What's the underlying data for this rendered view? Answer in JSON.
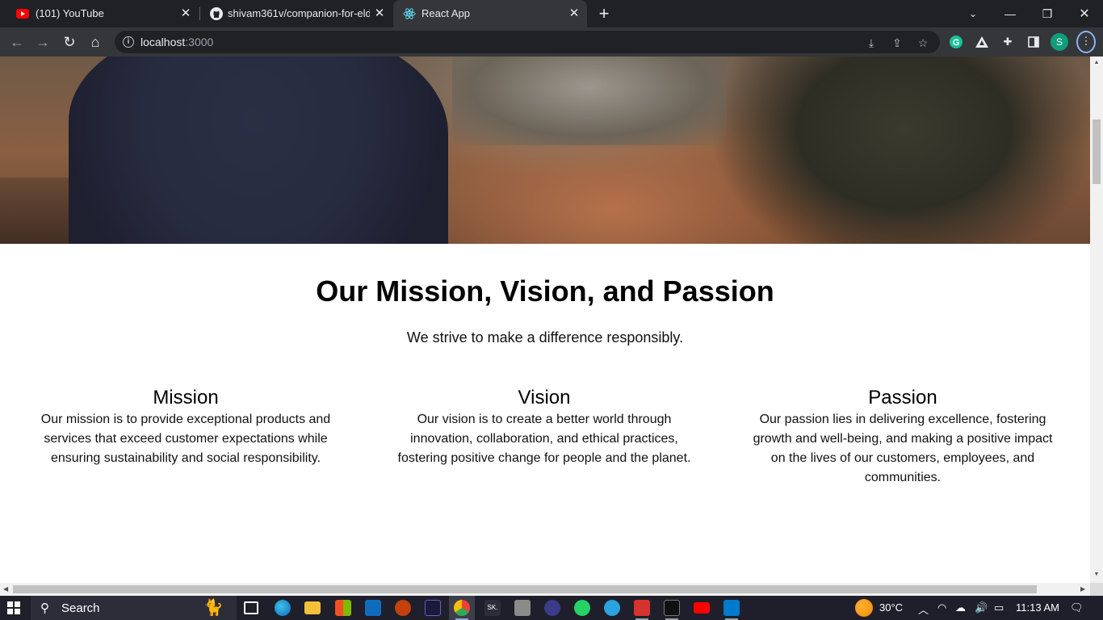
{
  "browser": {
    "tabs": [
      {
        "title": "(101) YouTube",
        "icon": "youtube-icon",
        "active": false
      },
      {
        "title": "shivam361v/companion-for-elde",
        "icon": "github-icon",
        "active": false
      },
      {
        "title": "React App",
        "icon": "react-icon",
        "active": true
      }
    ],
    "address": {
      "host": "localhost",
      "port": ":3000"
    },
    "profile_initial": "S"
  },
  "page": {
    "section_title": "Our Mission, Vision, and Passion",
    "section_subtitle": "We strive to make a difference responsibly.",
    "columns": [
      {
        "heading": "Mission",
        "text": "Our mission is to provide exceptional products and services that exceed customer expectations while ensuring sustainability and social responsibility."
      },
      {
        "heading": "Vision",
        "text": "Our vision is to create a better world through innovation, collaboration, and ethical practices, fostering positive change for people and the planet."
      },
      {
        "heading": "Passion",
        "text": "Our passion lies in delivering excellence, fostering growth and well-being, and making a positive impact on the lives of our customers, employees, and communities."
      }
    ]
  },
  "taskbar": {
    "search_label": "Search",
    "temperature": "30°C",
    "time": "11:13 AM"
  },
  "colors": {
    "tabbar_bg": "#202124",
    "toolbar_bg": "#35363a",
    "taskbar_bg": "#1f1f2b",
    "page_bg": "#ffffff"
  }
}
